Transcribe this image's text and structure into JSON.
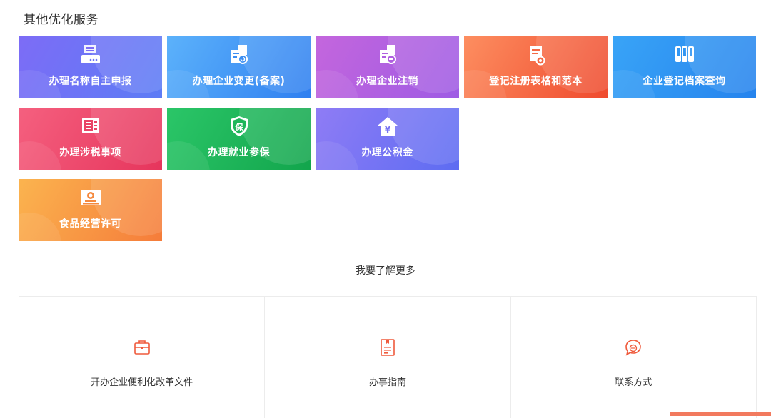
{
  "section": {
    "title": "其他优化服务"
  },
  "tiles": [
    {
      "label": "办理名称自主申报",
      "icon": "name-declare-icon",
      "color_from": "#7d6cf6",
      "color_to": "#5c7cf5"
    },
    {
      "label": "办理企业变更(备案)",
      "icon": "enterprise-change-icon",
      "color_from": "#5cb2fb",
      "color_to": "#2f7ff0"
    },
    {
      "label": "办理企业注销",
      "icon": "enterprise-cancel-icon",
      "color_from": "#c466dd",
      "color_to": "#9e5be4"
    },
    {
      "label": "登记注册表格和范本",
      "icon": "form-template-icon",
      "color_from": "#fd8e60",
      "color_to": "#ef4a2e"
    },
    {
      "label": "企业登记档案查询",
      "icon": "archive-query-icon",
      "color_from": "#39a4f7",
      "color_to": "#2583ed"
    },
    {
      "label": "办理涉税事项",
      "icon": "tax-icon",
      "color_from": "#f5607f",
      "color_to": "#e6355c"
    },
    {
      "label": "办理就业参保",
      "icon": "insurance-shield-icon",
      "color_from": "#2bc668",
      "color_to": "#12a54c"
    },
    {
      "label": "办理公积金",
      "icon": "housing-fund-icon",
      "color_from": "#8f7cf5",
      "color_to": "#5d6cf2"
    },
    {
      "label": "食品经营许可",
      "icon": "food-license-icon",
      "color_from": "#fbb44f",
      "color_to": "#f57c3a"
    }
  ],
  "more": {
    "title": "我要了解更多",
    "cards": [
      {
        "label": "开办企业便利化改革文件",
        "icon": "briefcase-icon"
      },
      {
        "label": "办事指南",
        "icon": "guide-book-icon"
      },
      {
        "label": "联系方式",
        "icon": "chat-bubble-icon"
      }
    ]
  },
  "colors": {
    "accent": "#ef5a3c",
    "border": "#ececec",
    "text": "#333333"
  }
}
